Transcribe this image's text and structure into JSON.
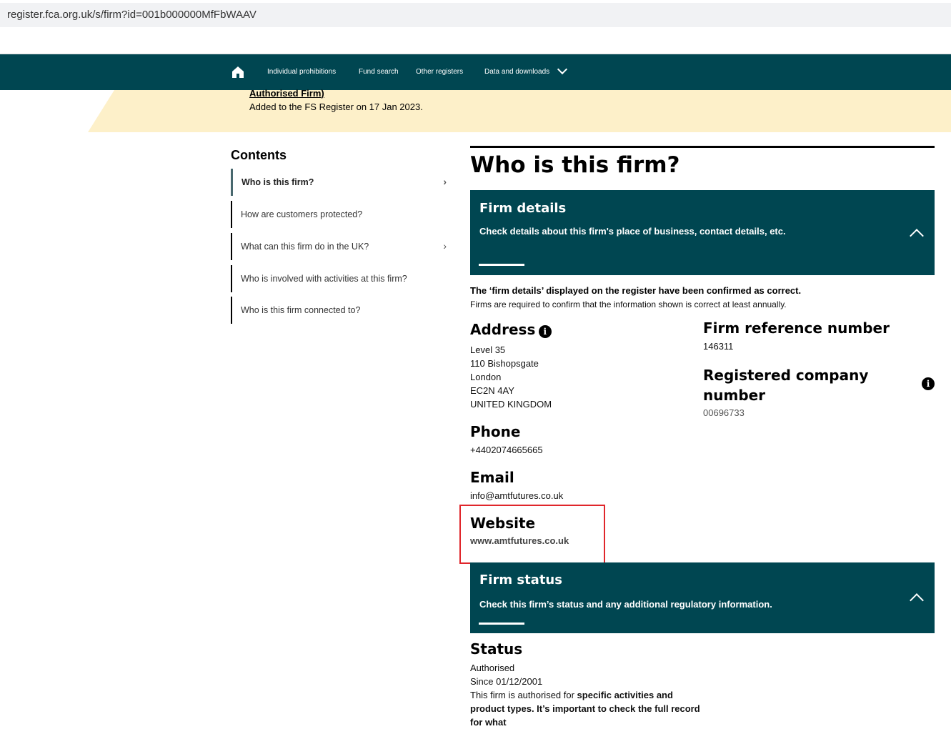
{
  "url": "register.fca.org.uk/s/firm?id=001b000000MfFbWAAV",
  "nav": [
    "Individual prohibitions",
    "Fund search",
    "Other registers",
    "Data and downloads"
  ],
  "banner": {
    "link": "Authorised Firm",
    "paren": ")",
    "added": "Added to the FS Register on 17 Jan 2023."
  },
  "contents": {
    "title": "Contents",
    "items": [
      "Who is this firm?",
      "How are customers protected?",
      "What can this firm do in the UK?",
      "Who is involved with activities at this firm?",
      "Who is this firm connected to?"
    ]
  },
  "title": "Who is this firm?",
  "firm_details": {
    "title": "Firm details",
    "subtitle": "Check details about this firm's place of business, contact details, etc."
  },
  "confirm": {
    "bold": "The ‘firm details’ displayed on the register have been confirmed as correct.",
    "text": "Firms are required to confirm that the information shown is correct at least annually."
  },
  "address": {
    "label": "Address",
    "lines": [
      "Level 35",
      "110 Bishopsgate",
      "London",
      "EC2N 4AY",
      "UNITED KINGDOM"
    ]
  },
  "frn": {
    "label": "Firm reference number",
    "value": "146311"
  },
  "company": {
    "label": "Registered company number",
    "value": "00696733"
  },
  "phone": {
    "label": "Phone",
    "value": "+4402074665665"
  },
  "email": {
    "label": "Email",
    "value": "info@amtfutures.co.uk"
  },
  "website": {
    "label": "Website",
    "value": "www.amtfutures.co.uk"
  },
  "firm_status": {
    "title": "Firm status",
    "subtitle": "Check this firm’s status and any additional regulatory information."
  },
  "status": {
    "label": "Status",
    "value": "Authorised",
    "since": "Since 01/12/2001",
    "desc1": "This firm is authorised for ",
    "desc_bold": "specific activities and product types. It’s important to check the full record for what"
  },
  "colors": {
    "brand": "#004651",
    "banner": "#fdf0c9",
    "highlight": "#e0262b"
  }
}
